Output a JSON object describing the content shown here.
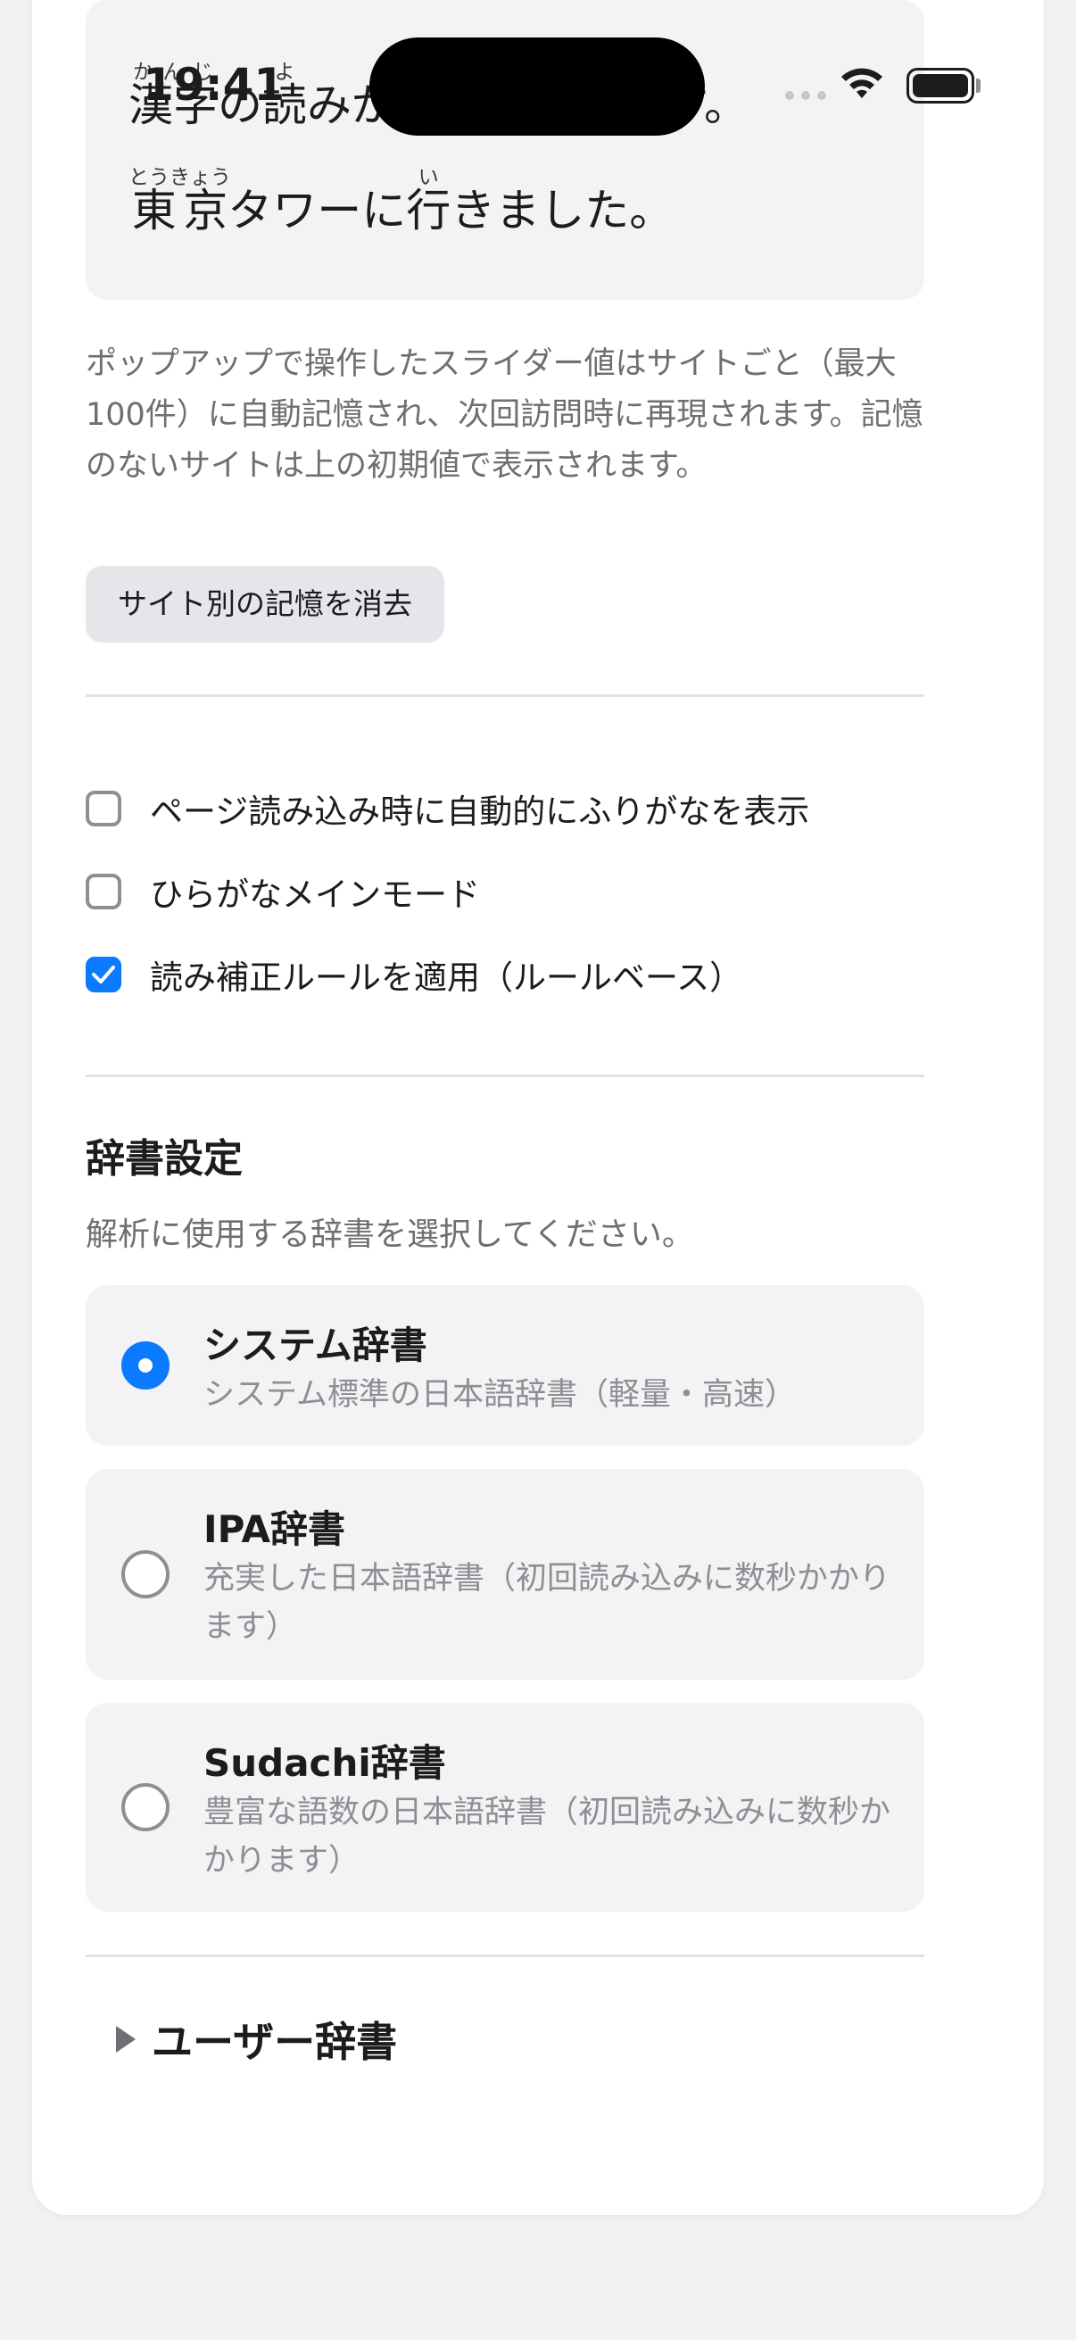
{
  "status_bar": {
    "time": "19:41"
  },
  "preview": {
    "line1": {
      "kanji1": "漢字",
      "ruby1": "かんじ",
      "middle": "の",
      "kanji2": "読",
      "ruby2": "よ",
      "tail": "みがなを表示します。"
    },
    "line2": {
      "kanji1": "東京",
      "ruby1": "とうきょう",
      "middle": "タワーに",
      "kanji2": "行",
      "ruby2": "い",
      "tail": "きました。"
    }
  },
  "note": "ポップアップで操作したスライダー値はサイトごと（最大100件）に自動記憶され、次回訪問時に再現されます。記憶のないサイトは上の初期値で表示されます。",
  "clear_button": "サイト別の記憶を消去",
  "options": [
    {
      "label": "ページ読み込み時に自動的にふりがなを表示",
      "checked": false
    },
    {
      "label": "ひらがなメインモード",
      "checked": false
    },
    {
      "label": "読み補正ルールを適用（ルールベース）",
      "checked": true
    }
  ],
  "dictionary": {
    "title": "辞書設定",
    "description": "解析に使用する辞書を選択してください。",
    "items": [
      {
        "name": "システム辞書",
        "desc": "システム標準の日本語辞書（軽量・高速）",
        "selected": true
      },
      {
        "name": "IPA辞書",
        "desc": "充実した日本語辞書（初回読み込みに数秒かかります）",
        "selected": false
      },
      {
        "name": "Sudachi辞書",
        "desc": "豊富な語数の日本語辞書（初回読み込みに数秒かかります）",
        "selected": false
      }
    ]
  },
  "user_dictionary": "ユーザー辞書",
  "colors": {
    "accent": "#0a7aff",
    "background": "#f2f2f4",
    "card": "#ffffff",
    "option_bg": "#f3f3f5",
    "secondary_text": "#6e6e73"
  }
}
